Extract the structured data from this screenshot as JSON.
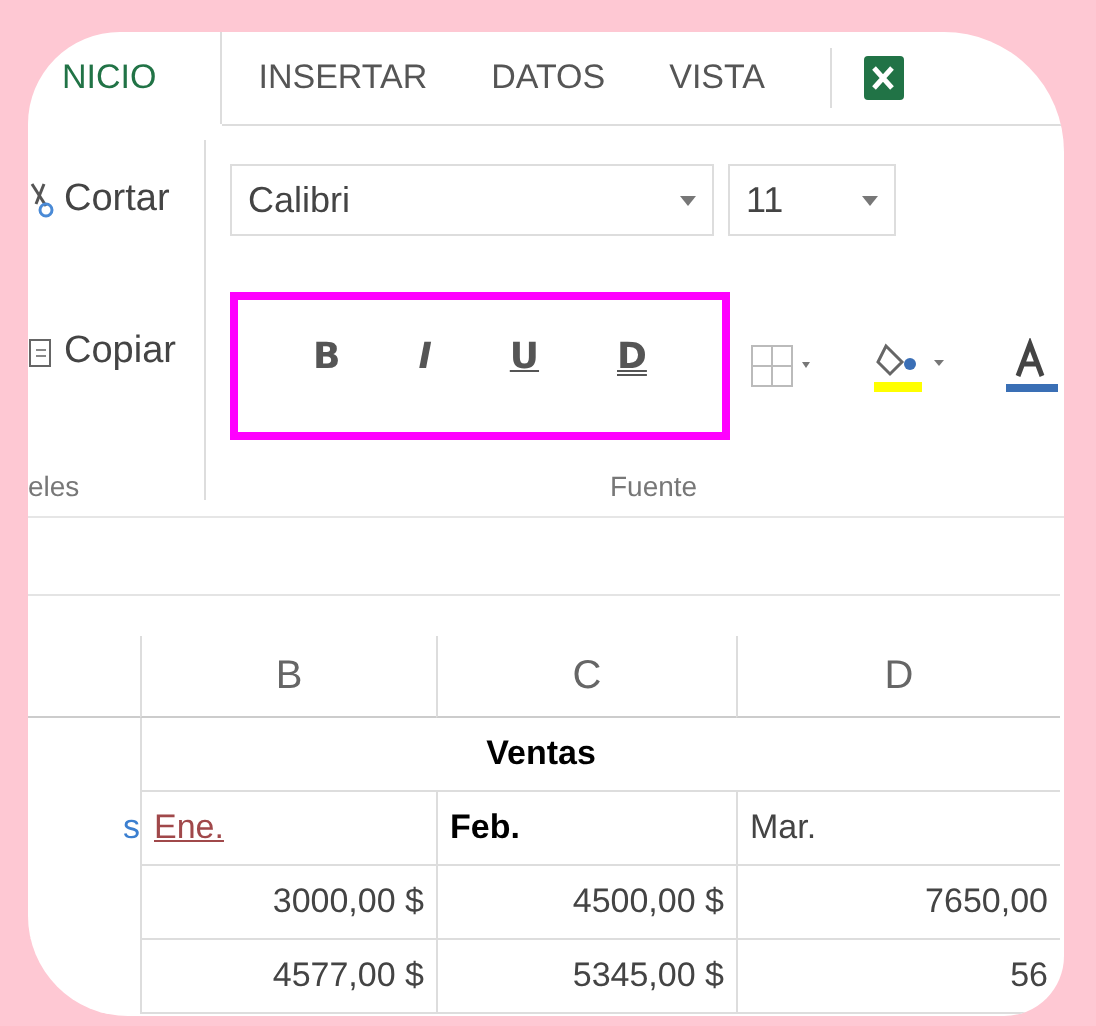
{
  "tabs": [
    {
      "label": "NICIO",
      "selected": true
    },
    {
      "label": "INSERTAR",
      "selected": false
    },
    {
      "label": "DATOS",
      "selected": false
    },
    {
      "label": "VISTA",
      "selected": false
    }
  ],
  "clipboard": {
    "cut": "Cortar",
    "copy": "Copiar",
    "group_label": "eles"
  },
  "font": {
    "name": "Calibri",
    "size": "11",
    "group_label": "Fuente",
    "style_buttons": [
      {
        "kind": "bold",
        "label": "B"
      },
      {
        "kind": "italic",
        "label": "I"
      },
      {
        "kind": "underline",
        "label": "U"
      },
      {
        "kind": "double",
        "label": "D"
      }
    ]
  },
  "sheet": {
    "columns": [
      "B",
      "C",
      "D"
    ],
    "title": "Ventas",
    "rows": [
      {
        "row_label": "s",
        "cells": [
          {
            "text": "Ene.",
            "kind": "link"
          },
          {
            "text": "Feb.",
            "kind": "bold"
          },
          {
            "text": "Mar.",
            "kind": "plain"
          }
        ]
      },
      {
        "cells": [
          {
            "text": "3000,00 $",
            "kind": "number"
          },
          {
            "text": "4500,00 $",
            "kind": "number"
          },
          {
            "text": "7650,00",
            "kind": "number"
          }
        ]
      },
      {
        "cells": [
          {
            "text": "4577,00 $",
            "kind": "number"
          },
          {
            "text": "5345,00 $",
            "kind": "number"
          },
          {
            "text": "56",
            "kind": "number"
          }
        ]
      }
    ]
  }
}
